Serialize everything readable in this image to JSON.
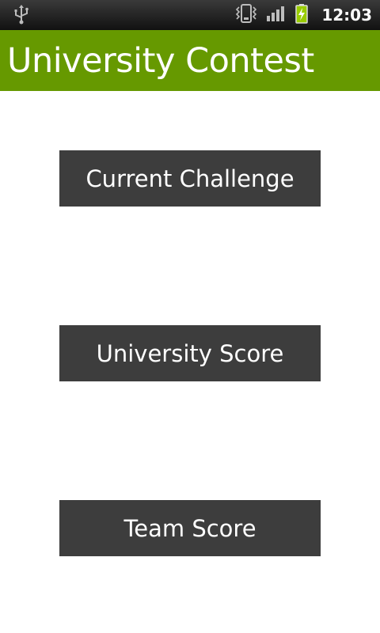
{
  "status_bar": {
    "time": "12:03",
    "icons": [
      "usb-icon",
      "vibrate-icon",
      "signal-icon",
      "battery-charging-icon"
    ],
    "accent": "#99cc00"
  },
  "app": {
    "title": "University Contest",
    "title_bar_color": "#669900"
  },
  "menu": {
    "button_color": "#3d3d3d",
    "items": [
      {
        "label": "Current Challenge"
      },
      {
        "label": "University Score"
      },
      {
        "label": "Team Score"
      }
    ]
  }
}
